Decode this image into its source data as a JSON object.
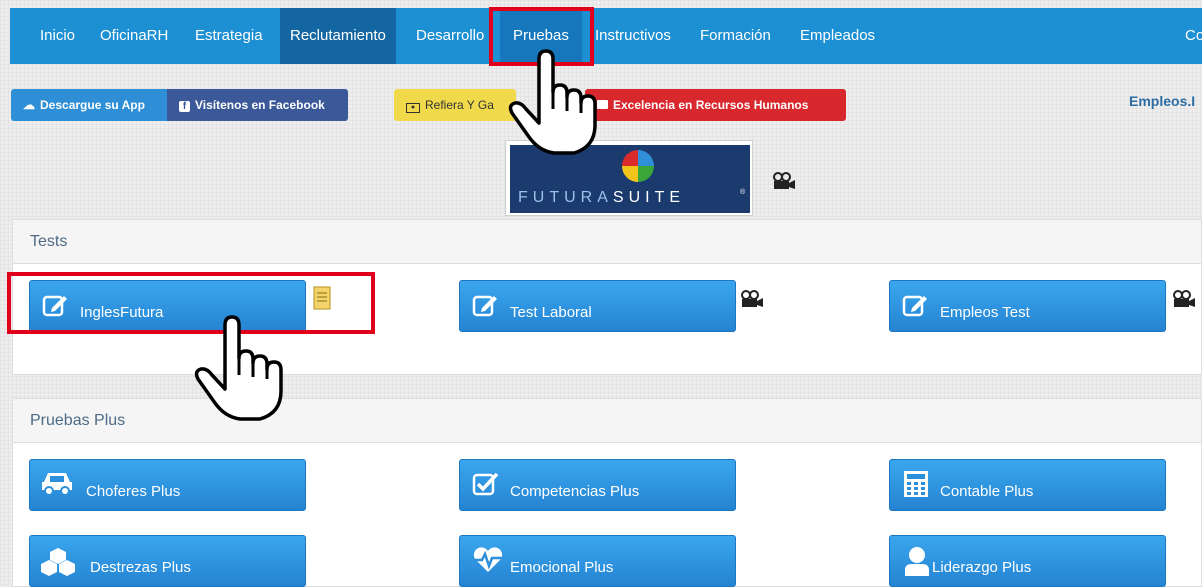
{
  "nav": {
    "items": [
      {
        "label": "Inicio"
      },
      {
        "label": "OficinaRH"
      },
      {
        "label": "Estrategia"
      },
      {
        "label": "Reclutamiento"
      },
      {
        "label": "Desarrollo"
      },
      {
        "label": "Pruebas"
      },
      {
        "label": "Instructivos"
      },
      {
        "label": "Formación"
      },
      {
        "label": "Empleados"
      },
      {
        "label": "Co"
      }
    ]
  },
  "buttons": {
    "app": "Descargue su App",
    "facebook": "Visítenos en Facebook",
    "refiera": "Refiera Y Ga",
    "excelencia": "Excelencia en Recursos Humanos",
    "empleos_link": "Empleos.I"
  },
  "logo": {
    "part1": "FUTURA",
    "part2": "SUITE",
    "reg": "®"
  },
  "tests": {
    "title": "Tests",
    "items": [
      {
        "label": "InglesFutura"
      },
      {
        "label": "Test Laboral"
      },
      {
        "label": "Empleos Test"
      }
    ]
  },
  "plus": {
    "title": "Pruebas Plus",
    "items": [
      {
        "label": "Choferes Plus"
      },
      {
        "label": "Competencias Plus"
      },
      {
        "label": "Contable Plus"
      },
      {
        "label": "Destrezas Plus"
      },
      {
        "label": "Emocional Plus"
      },
      {
        "label": "Liderazgo Plus"
      }
    ]
  },
  "colors": {
    "nav": "#1d8fd3",
    "button": "#2b8fdc",
    "highlight": "#e0001b"
  }
}
